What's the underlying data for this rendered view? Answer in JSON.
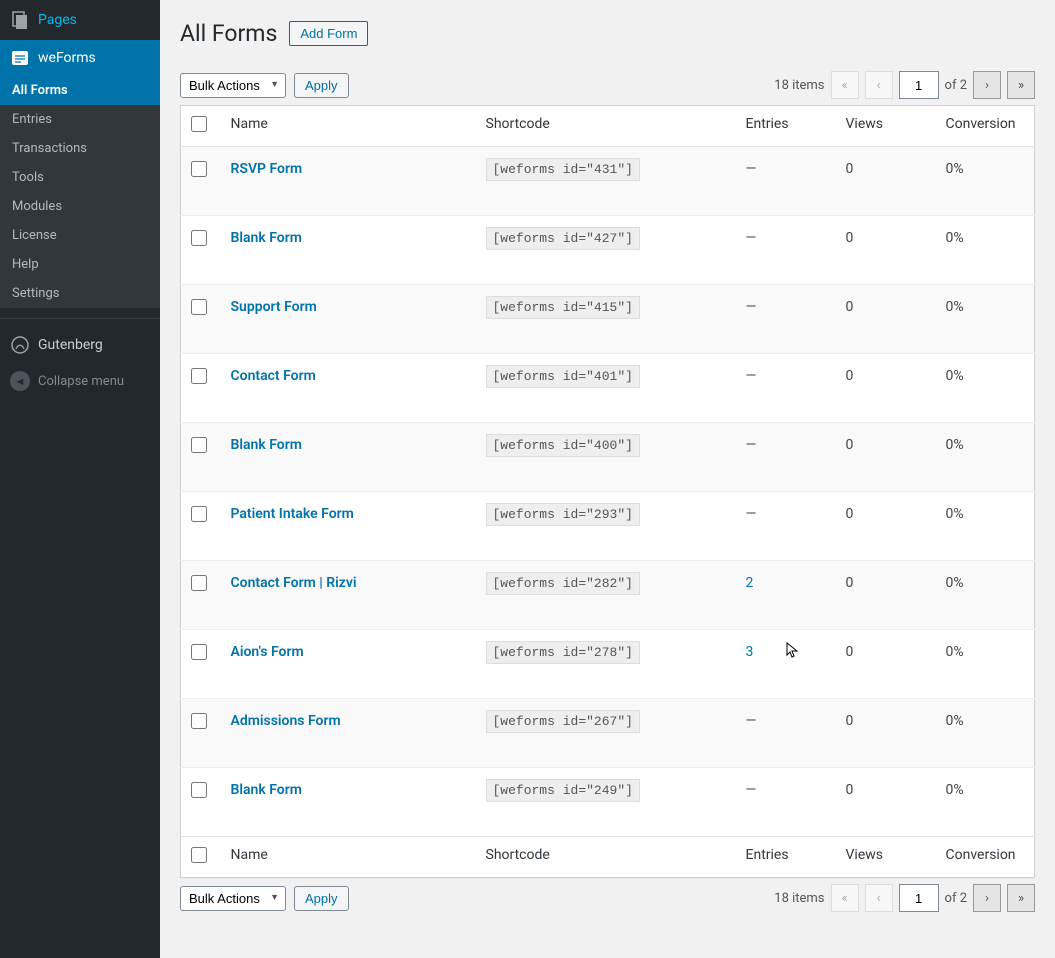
{
  "sidebar": {
    "pages_label": "Pages",
    "weforms_label": "weForms",
    "submenu": [
      {
        "label": "All Forms",
        "current": true
      },
      {
        "label": "Entries",
        "current": false
      },
      {
        "label": "Transactions",
        "current": false
      },
      {
        "label": "Tools",
        "current": false
      },
      {
        "label": "Modules",
        "current": false
      },
      {
        "label": "License",
        "current": false
      },
      {
        "label": "Help",
        "current": false
      },
      {
        "label": "Settings",
        "current": false
      }
    ],
    "gutenberg_label": "Gutenberg",
    "collapse_label": "Collapse menu"
  },
  "header": {
    "title": "All Forms",
    "add_button": "Add Form"
  },
  "bulk": {
    "placeholder": "Bulk Actions",
    "apply": "Apply"
  },
  "pagination": {
    "items_text": "18 items",
    "current_page": "1",
    "of_text": "of 2",
    "first": "«",
    "prev": "‹",
    "next": "›",
    "last": "»"
  },
  "table": {
    "headers": {
      "name": "Name",
      "shortcode": "Shortcode",
      "entries": "Entries",
      "views": "Views",
      "conversion": "Conversion"
    },
    "rows": [
      {
        "name": "RSVP Form",
        "shortcode": "[weforms id=\"431\"]",
        "entries": "—",
        "entries_link": false,
        "views": "0",
        "conversion": "0%"
      },
      {
        "name": "Blank Form",
        "shortcode": "[weforms id=\"427\"]",
        "entries": "—",
        "entries_link": false,
        "views": "0",
        "conversion": "0%"
      },
      {
        "name": "Support Form",
        "shortcode": "[weforms id=\"415\"]",
        "entries": "—",
        "entries_link": false,
        "views": "0",
        "conversion": "0%"
      },
      {
        "name": "Contact Form",
        "shortcode": "[weforms id=\"401\"]",
        "entries": "—",
        "entries_link": false,
        "views": "0",
        "conversion": "0%"
      },
      {
        "name": "Blank Form",
        "shortcode": "[weforms id=\"400\"]",
        "entries": "—",
        "entries_link": false,
        "views": "0",
        "conversion": "0%"
      },
      {
        "name": "Patient Intake Form",
        "shortcode": "[weforms id=\"293\"]",
        "entries": "—",
        "entries_link": false,
        "views": "0",
        "conversion": "0%"
      },
      {
        "name": "Contact Form | Rizvi",
        "shortcode": "[weforms id=\"282\"]",
        "entries": "2",
        "entries_link": true,
        "views": "0",
        "conversion": "0%"
      },
      {
        "name": "Aion's Form",
        "shortcode": "[weforms id=\"278\"]",
        "entries": "3",
        "entries_link": true,
        "views": "0",
        "conversion": "0%"
      },
      {
        "name": "Admissions Form",
        "shortcode": "[weforms id=\"267\"]",
        "entries": "—",
        "entries_link": false,
        "views": "0",
        "conversion": "0%"
      },
      {
        "name": "Blank Form",
        "shortcode": "[weforms id=\"249\"]",
        "entries": "—",
        "entries_link": false,
        "views": "0",
        "conversion": "0%"
      }
    ]
  }
}
